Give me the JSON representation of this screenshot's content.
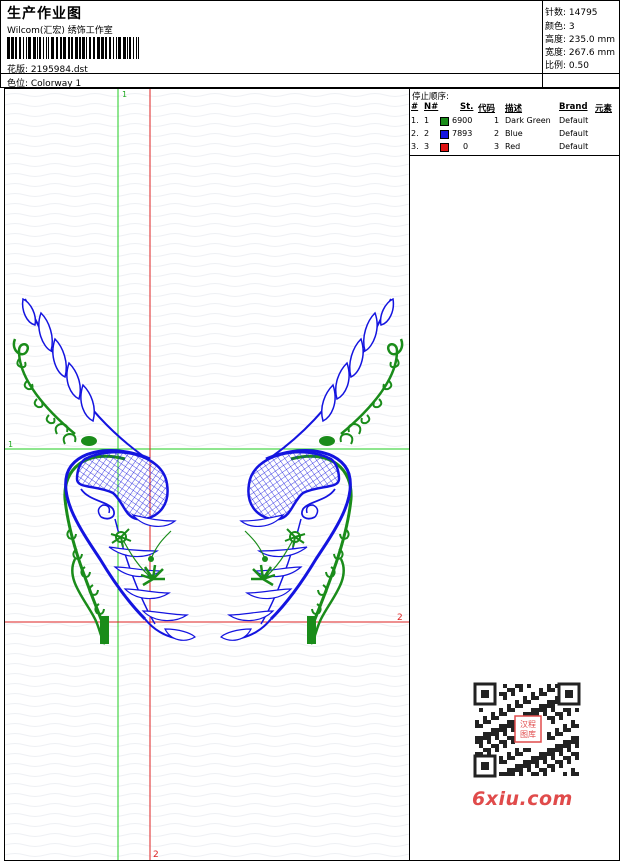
{
  "header": {
    "title": "生产作业图",
    "company": "Wilcom(汇宏) 绣饰工作室",
    "design_file_label": "花版: 2195984.dst",
    "colorway_label": "色位: Colorway 1"
  },
  "stats": {
    "stitches": "针数: 14795",
    "colors": "颜色: 3",
    "height": "高度: 235.0 mm",
    "width": "宽度: 267.6 mm",
    "scale": "比例: 0.50"
  },
  "guides": {
    "vertical_1_label": "1",
    "horizontal_1_label": "1",
    "horizontal_2_label": "2",
    "vertical_2_label": "2"
  },
  "stop_sequence": {
    "title": "停止顺序:",
    "columns": [
      "#",
      "N#",
      "St.",
      "代码",
      "描述",
      "Brand",
      "元素"
    ],
    "rows": [
      {
        "num": "1.",
        "n": "1",
        "color": "#1a8c1a",
        "stitches": "6900",
        "code": "1",
        "desc": "Dark Green",
        "brand": "Default"
      },
      {
        "num": "2.",
        "n": "2",
        "color": "#1414e0",
        "stitches": "7893",
        "code": "2",
        "desc": "Blue",
        "brand": "Default"
      },
      {
        "num": "3.",
        "n": "3",
        "color": "#e01414",
        "stitches": "0",
        "code": "3",
        "desc": "Red",
        "brand": "Default"
      }
    ]
  },
  "colors": {
    "green": "#1a8c1a",
    "blue": "#1414e0",
    "red": "#e01414",
    "guide_green": "#22cc22",
    "guide_red": "#dd2222"
  },
  "watermark": {
    "text": "6xiu.com",
    "seal": "汉程图库"
  }
}
